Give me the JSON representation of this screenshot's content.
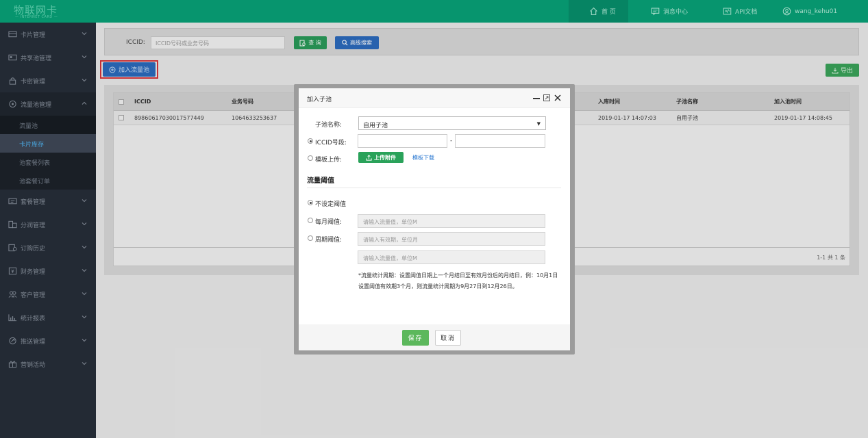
{
  "app": {
    "logo_main": "物联网卡",
    "logo_sub": "— INTERNET CARD —"
  },
  "topnav": {
    "home": "首 页",
    "messages": "消息中心",
    "api": "API文档",
    "user": "wang_kehu01"
  },
  "sidebar": {
    "items": [
      {
        "label": "卡片管理",
        "icon": "card-icon"
      },
      {
        "label": "共享池管理",
        "icon": "share-pool-icon"
      },
      {
        "label": "卡密管理",
        "icon": "lock-icon"
      },
      {
        "label": "流量池管理",
        "icon": "traffic-pool-icon"
      },
      {
        "label": "套餐管理",
        "icon": "package-icon"
      },
      {
        "label": "分润管理",
        "icon": "profit-icon"
      },
      {
        "label": "订购历史",
        "icon": "history-icon"
      },
      {
        "label": "财务管理",
        "icon": "finance-icon"
      },
      {
        "label": "客户管理",
        "icon": "customers-icon"
      },
      {
        "label": "统计报表",
        "icon": "chart-icon"
      },
      {
        "label": "推送管理",
        "icon": "push-icon"
      },
      {
        "label": "营销活动",
        "icon": "gift-icon"
      }
    ],
    "subitems": [
      "流量池",
      "卡片库存",
      "池套餐列表",
      "池套餐订单"
    ]
  },
  "search": {
    "label": "ICCID:",
    "placeholder": "ICCID号码或业务号码",
    "query_label": "查 询",
    "advanced_label": "高级搜索"
  },
  "actions": {
    "add_pool": "加入流量池",
    "export": "导出"
  },
  "table": {
    "columns": [
      "ICCID",
      "业务号码",
      "入库时间",
      "子池名称",
      "加入池时间"
    ],
    "rows": [
      {
        "iccid": "89860617030017577449",
        "number": "1064633253637",
        "stock_time": "2019-01-17 14:07:03",
        "subpool": "自用子池",
        "join_time": "2019-01-17 14:08:45"
      }
    ],
    "pagination": "1-1  共 1 条"
  },
  "modal": {
    "title": "加入子池",
    "subpool_label": "子池名称:",
    "subpool_value": "自用子池",
    "iccid_range_label": "ICCID号段:",
    "iccid_dash": "-",
    "template_label": "模板上传:",
    "upload_label": "上传附件",
    "template_download": "模板下载",
    "section_title": "流量阈值",
    "no_threshold": "不设定阈值",
    "monthly_label": "每月阈值:",
    "monthly_placeholder": "请输入流量值，单位M",
    "period_label": "周期阈值:",
    "period_placeholder": "请输入有效期，单位月",
    "period_traffic_placeholder": "请输入流量值，单位M",
    "note": "*流量统计周期：设置阈值日期上一个月结日至有效月份后的月结日，例：10月1日设置阈值有效期3个月，则流量统计周期为9月27日到12月26日。",
    "save": "保存",
    "cancel": "取消"
  },
  "colors": {
    "topbar": "#07956e",
    "sidebar": "#232a34",
    "primary_blue": "#2c6bbd",
    "success_green": "#5cb85c",
    "highlight_red": "#d6323a"
  }
}
